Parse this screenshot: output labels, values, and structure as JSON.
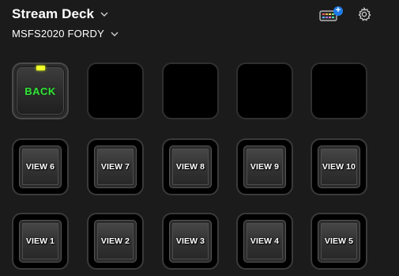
{
  "header": {
    "device_name": "Stream Deck",
    "profile_name": "MSFS2020 FORDY"
  },
  "toolbar": {
    "store_badge": "+"
  },
  "colors": {
    "background": "#1b1b1b",
    "back_label": "#34e23a",
    "back_led": "#f1ff2a",
    "store_badge": "#1e7be8"
  },
  "keys": [
    {
      "label": "BACK",
      "type": "back"
    },
    {
      "label": "",
      "type": "empty"
    },
    {
      "label": "",
      "type": "empty"
    },
    {
      "label": "",
      "type": "empty"
    },
    {
      "label": "",
      "type": "empty"
    },
    {
      "label": "VIEW 6",
      "type": "view"
    },
    {
      "label": "VIEW 7",
      "type": "view"
    },
    {
      "label": "VIEW 8",
      "type": "view"
    },
    {
      "label": "VIEW 9",
      "type": "view"
    },
    {
      "label": "VIEW 10",
      "type": "view"
    },
    {
      "label": "VIEW 1",
      "type": "view"
    },
    {
      "label": "VIEW 2",
      "type": "view"
    },
    {
      "label": "VIEW 3",
      "type": "view"
    },
    {
      "label": "VIEW 4",
      "type": "view"
    },
    {
      "label": "VIEW 5",
      "type": "view"
    }
  ]
}
